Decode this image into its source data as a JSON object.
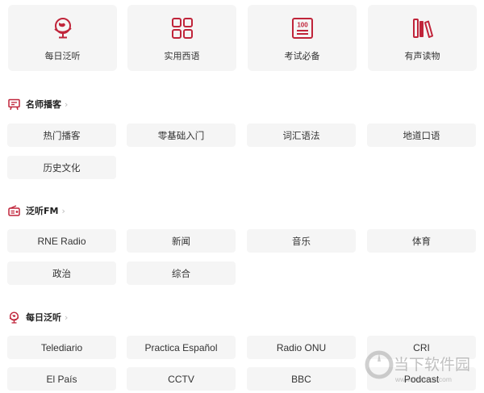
{
  "categories": [
    {
      "label": "每日泛听",
      "icon": "globe-icon"
    },
    {
      "label": "实用西语",
      "icon": "grid-icon"
    },
    {
      "label": "考试必备",
      "icon": "score-100-icon"
    },
    {
      "label": "有声读物",
      "icon": "books-icon"
    }
  ],
  "sections": {
    "podcasts": {
      "title": "名师播客",
      "icon": "podcast-icon",
      "chevron": "›",
      "tags": [
        "热门播客",
        "零基础入门",
        "词汇语法",
        "地道口语",
        "历史文化"
      ]
    },
    "fm": {
      "title": "泛听FM",
      "icon": "radio-icon",
      "chevron": "›",
      "tags": [
        "RNE Radio",
        "新闻",
        "音乐",
        "体育",
        "政治",
        "综合"
      ]
    },
    "daily": {
      "title": "每日泛听",
      "icon": "globe-icon",
      "chevron": "›",
      "tags": [
        "Telediario",
        "Practica Español",
        "Radio ONU",
        "CRI",
        "El País",
        "CCTV",
        "BBC",
        "Podcast"
      ]
    }
  },
  "watermark": {
    "text": "当下软件园",
    "url": "www.downxia.com"
  },
  "colors": {
    "accent": "#c0243a",
    "card_bg": "#f5f5f5",
    "text": "#333333"
  }
}
